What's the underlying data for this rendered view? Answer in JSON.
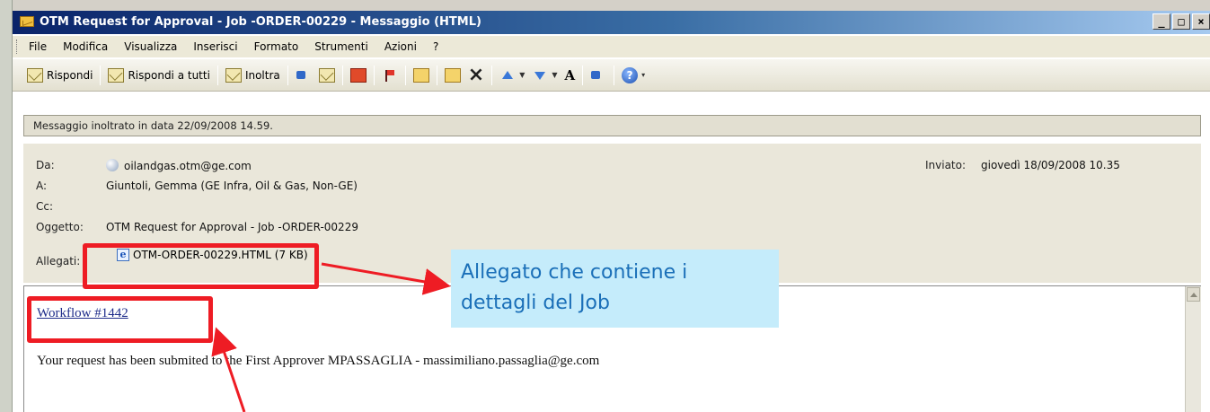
{
  "window": {
    "title": "OTM Request for Approval - Job -ORDER-00229 - Messaggio (HTML)",
    "minimize_glyph": "_",
    "maximize_glyph": "□",
    "close_glyph": "×"
  },
  "menubar": {
    "items": [
      "File",
      "Modifica",
      "Visualizza",
      "Inserisci",
      "Formato",
      "Strumenti",
      "Azioni",
      "?"
    ]
  },
  "toolbar": {
    "reply_label": "Rispondi",
    "reply_all_label": "Rispondi a tutti",
    "forward_label": "Inoltra",
    "delete_glyph": "×",
    "font_size_glyph": "A",
    "help_glyph": "?"
  },
  "message": {
    "forwarded_note": "Messaggio inoltrato in data 22/09/2008 14.59.",
    "from_label": "Da:",
    "from_value": "oilandgas.otm@ge.com",
    "to_label": "A:",
    "to_value": "Giuntoli, Gemma (GE Infra, Oil & Gas, Non-GE)",
    "cc_label": "Cc:",
    "cc_value": "",
    "subject_label": "Oggetto:",
    "subject_value": "OTM Request for Approval - Job -ORDER-00229",
    "sent_label": "Inviato:",
    "sent_value": "giovedì 18/09/2008 10.35",
    "attachments_label": "Allegati:",
    "attachment_name": "OTM-ORDER-00229.HTML (7 KB)",
    "attachment_icon": "ie-document-icon"
  },
  "body": {
    "workflow_link": "Workflow #1442",
    "text": "Your request has been submited to the First Approver MPASSAGLIA - massimiliano.passaglia@ge.com"
  },
  "annotation": {
    "callout_line1": "Allegato che contiene i",
    "callout_line2": "dettagli del Job",
    "highlight_color": "#ee1c24",
    "callout_bg": "#c5ecfb",
    "callout_text_color": "#1a6fb8"
  }
}
